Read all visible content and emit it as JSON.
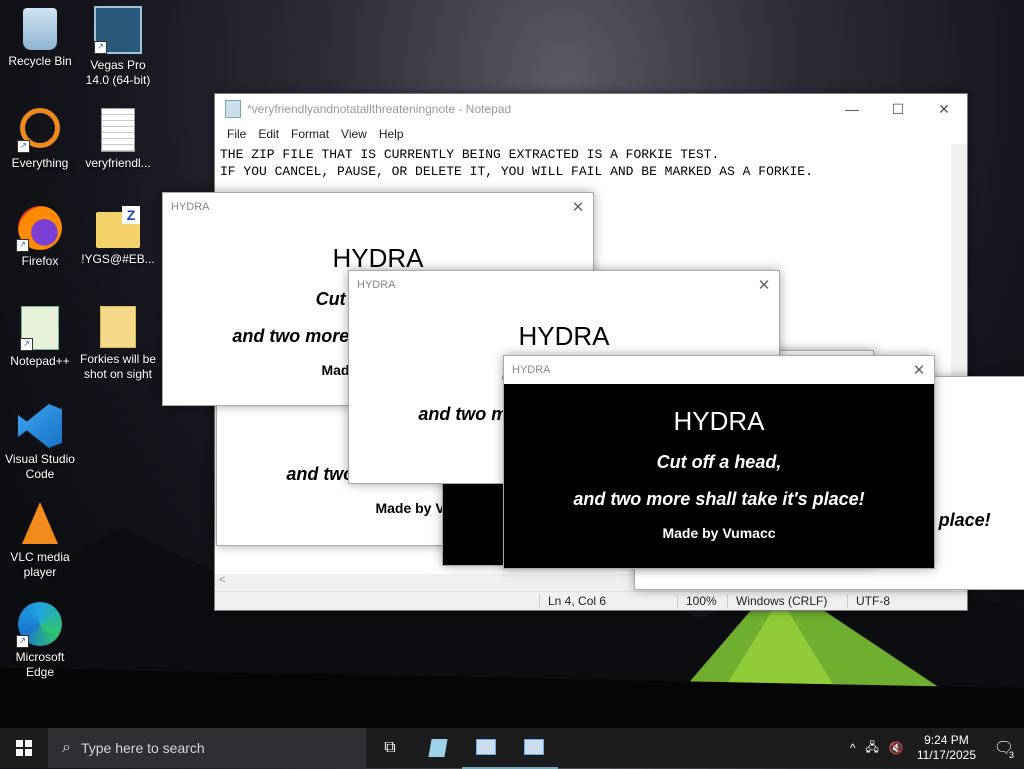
{
  "desktop": {
    "icons": [
      {
        "label": "Recycle Bin"
      },
      {
        "label": "Vegas Pro 14.0 (64-bit)"
      },
      {
        "label": "Everything"
      },
      {
        "label": "veryfriendl..."
      },
      {
        "label": "Firefox"
      },
      {
        "label": "!YGS@#EB..."
      },
      {
        "label": "Notepad++"
      },
      {
        "label": "Forkies will be shot on sight"
      },
      {
        "label": "Visual Studio Code"
      },
      {
        "label": "VLC media player"
      },
      {
        "label": "Microsoft Edge"
      }
    ]
  },
  "notepad": {
    "title": "*veryfriendlyandnotatallthreateningnote - Notepad",
    "menu": [
      "File",
      "Edit",
      "Format",
      "View",
      "Help"
    ],
    "text": "THE ZIP FILE THAT IS CURRENTLY BEING EXTRACTED IS A FORKIE TEST.\nIF YOU CANCEL, PAUSE, OR DELETE IT, YOU WILL FAIL AND BE MARKED AS A FORKIE.",
    "status": {
      "position": "Ln 4, Col 6",
      "zoom": "100%",
      "line_ending": "Windows (CRLF)",
      "encoding": "UTF-8"
    }
  },
  "hydra": {
    "window_title": "HYDRA",
    "heading": "HYDRA",
    "line1": "Cut off a head,",
    "line2": "and two more shall take it's place!",
    "credit": "Made by Vumacc",
    "close": "✕"
  },
  "taskbar": {
    "search_placeholder": "Type here to search",
    "time": "9:24 PM",
    "date": "11/17/2025",
    "notification_count": "3"
  },
  "colors": {
    "taskbar": "#1c1c1e",
    "hydra_black": "#000000",
    "hydra_white": "#ffffff"
  }
}
